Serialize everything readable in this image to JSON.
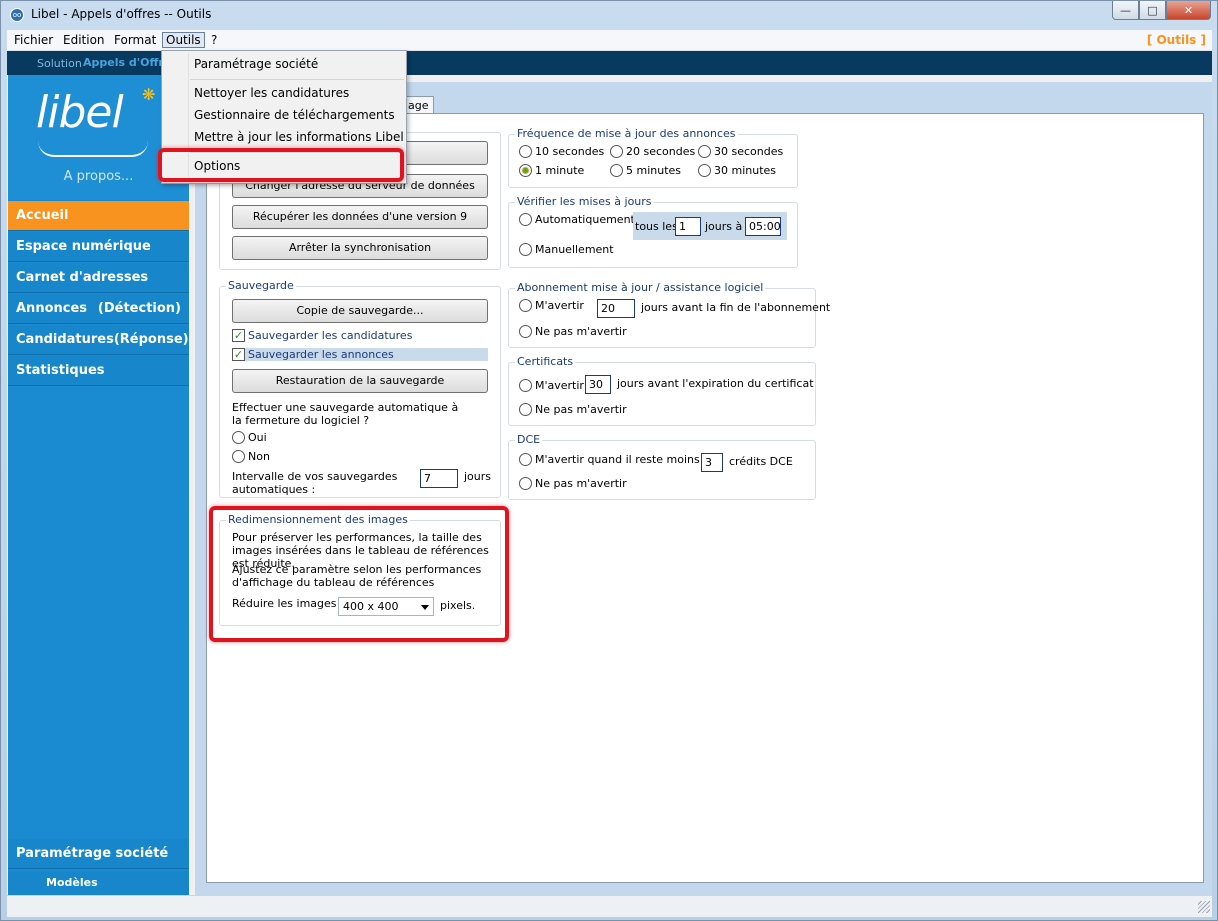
{
  "window": {
    "title": "Libel - Appels d'offres -- Outils",
    "app_icon": "libel-app-icon"
  },
  "menubar": {
    "items": [
      "Fichier",
      "Edition",
      "Format",
      "Outils",
      "?"
    ],
    "right_label": "[ Outils ]",
    "accent": "#f7931e"
  },
  "solution_bar": {
    "label": "Solution",
    "name": "Appels d'Offres"
  },
  "sidebar": {
    "logo": "libel",
    "about": "A propos...",
    "nav": [
      {
        "label": "Accueil",
        "extra": ""
      },
      {
        "label": "Espace numérique",
        "extra": ""
      },
      {
        "label": "Carnet d'adresses",
        "extra": ""
      },
      {
        "label": "Annonces",
        "extra": "(Détection)"
      },
      {
        "label": "Candidatures",
        "extra": "(Réponse)"
      },
      {
        "label": "Statistiques",
        "extra": ""
      }
    ],
    "bottom_nav": {
      "label": "Paramétrage société",
      "sub": "Modèles"
    }
  },
  "outils_menu": {
    "items": [
      "Paramétrage société",
      "Nettoyer les candidatures",
      "Gestionnaire de téléchargements",
      "Mettre à jour les informations Libel",
      "Options"
    ]
  },
  "tab": {
    "label": "age"
  },
  "sync": {
    "buttons": [
      "Changer l'adresse du serveur de données",
      "Récupérer les données d'une version 9",
      "Arrêter la synchronisation"
    ]
  },
  "sauvegarde": {
    "title": "Sauvegarde",
    "copy_button": "Copie de sauvegarde...",
    "check_candidatures": "Sauvegarder les candidatures",
    "check_annonces": "Sauvegarder les annonces",
    "restore_button": "Restauration de la sauvegarde",
    "auto_question": "Effectuer une sauvegarde automatique à la fermeture du logiciel ?",
    "oui": "Oui",
    "non": "Non",
    "interval_label": "Intervalle de vos sauvegardes automatiques :",
    "interval_value": "7",
    "interval_unit": "jours"
  },
  "images": {
    "title": "Redimensionnement des images",
    "text1": "Pour préserver les performances, la taille des images insérées dans le tableau de références est réduite.",
    "text2": "Ajustez ce paramètre selon les performances d'affichage du tableau de références",
    "reduce_label": "Réduire les images à",
    "size_value": "400 x 400",
    "unit": "pixels."
  },
  "frequence": {
    "title": "Fréquence de mise à jour des annonces",
    "options": [
      "10 secondes",
      "20 secondes",
      "30 secondes",
      "1 minute",
      "5 minutes",
      "30 minutes"
    ],
    "selected": "1 minute"
  },
  "verifier": {
    "title": "Vérifier les mises à jours",
    "auto": "Automatiquement :",
    "tous_les": "tous les",
    "days_value": "1",
    "jours_a": "jours à",
    "time_value": "05:00",
    "manual": "Manuellement"
  },
  "abonnement": {
    "title": "Abonnement mise à jour / assistance logiciel",
    "avertir": "M'avertir",
    "days_value": "20",
    "days_text": "jours avant la fin de l'abonnement",
    "ne_pas": "Ne pas m'avertir"
  },
  "certificats": {
    "title": "Certificats",
    "avertir": "M'avertir",
    "days_value": "30",
    "days_text": "jours avant l'expiration du  certificat",
    "ne_pas": "Ne pas m'avertir"
  },
  "dce": {
    "title": "DCE",
    "avertir": "M'avertir quand il reste moins de",
    "credits_value": "3",
    "credits_text": "crédits DCE",
    "ne_pas": "Ne pas m'avertir"
  },
  "colors": {
    "highlight": "#e0141e",
    "nav_active": "#f7931e",
    "nav_bg": "#1786cb",
    "topbar": "#083a60"
  }
}
